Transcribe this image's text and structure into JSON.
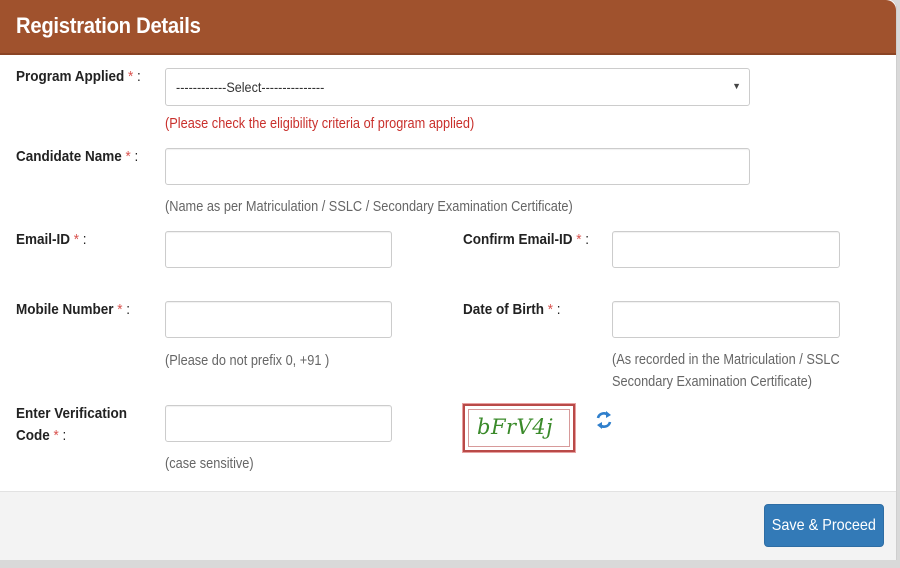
{
  "panel": {
    "title": "Registration Details",
    "header_color": "#a0522d"
  },
  "form": {
    "required_mark": "*",
    "colon": ":",
    "program": {
      "label": "Program Applied",
      "selected": "------------Select---------------",
      "hint": "(Please check the eligibility criteria of program applied)"
    },
    "candidate_name": {
      "label": "Candidate Name",
      "value": "",
      "hint": "(Name as per Matriculation / SSLC / Secondary Examination Certificate)"
    },
    "email": {
      "label": "Email-ID",
      "value": ""
    },
    "confirm_email": {
      "label": "Confirm Email-ID",
      "value": ""
    },
    "mobile": {
      "label": "Mobile Number",
      "value": "",
      "hint": "(Please do not prefix 0, +91 )"
    },
    "dob": {
      "label": "Date of Birth",
      "value": "",
      "hint_line1": "(As recorded in the Matriculation / SSLC",
      "hint_line2": "Secondary Examination Certificate)"
    },
    "verification": {
      "label_line1": "Enter Verification",
      "label_line2": "Code",
      "value": "",
      "hint": "(case sensitive)",
      "captcha_text": "bFrV4j",
      "refresh_icon": "refresh-icon"
    }
  },
  "footer": {
    "submit_label": "Save & Proceed",
    "submit_color": "#337ab7"
  }
}
